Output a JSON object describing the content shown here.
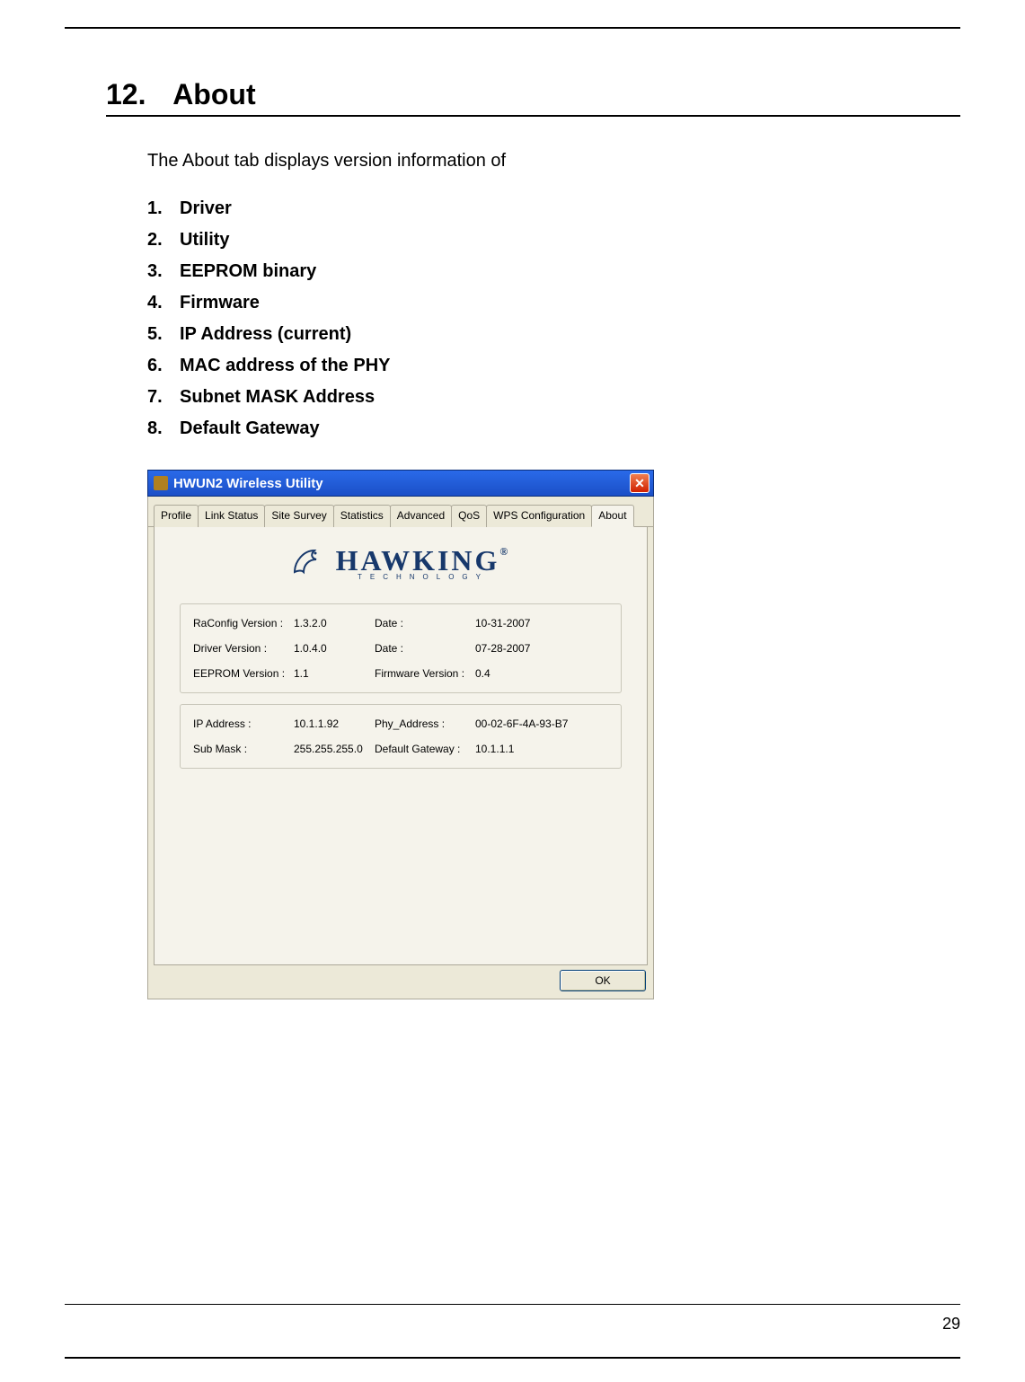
{
  "heading": {
    "num": "12.",
    "title": "About"
  },
  "intro": "The About tab displays version information of",
  "items": [
    {
      "n": "1.",
      "t": "Driver"
    },
    {
      "n": "2.",
      "t": "Utility"
    },
    {
      "n": "3.",
      "t": "EEPROM binary"
    },
    {
      "n": "4.",
      "t": "Firmware"
    },
    {
      "n": "5.",
      "t": "IP Address (current)"
    },
    {
      "n": "6.",
      "t": "MAC address of the PHY"
    },
    {
      "n": "7.",
      "t": "Subnet MASK Address"
    },
    {
      "n": "8.",
      "t": "Default Gateway"
    }
  ],
  "window": {
    "title": "HWUN2 Wireless Utility",
    "close_glyph": "✕",
    "tabs": [
      "Profile",
      "Link Status",
      "Site Survey",
      "Statistics",
      "Advanced",
      "QoS",
      "WPS Configuration",
      "About"
    ],
    "active_tab_index": 7,
    "logo_main": "HAWKING",
    "logo_sub": "TECHNOLOGY",
    "logo_reg": "®",
    "group1": {
      "r1": {
        "l1": "RaConfig Version :",
        "v1": "1.3.2.0",
        "l2": "Date :",
        "v2": "10-31-2007"
      },
      "r2": {
        "l1": "Driver Version :",
        "v1": "1.0.4.0",
        "l2": "Date :",
        "v2": "07-28-2007"
      },
      "r3": {
        "l1": "EEPROM Version :",
        "v1": "1.1",
        "l2": "Firmware Version :",
        "v2": "0.4"
      }
    },
    "group2": {
      "r1": {
        "l1": "IP Address :",
        "v1": "10.1.1.92",
        "l2": "Phy_Address :",
        "v2": "00-02-6F-4A-93-B7"
      },
      "r2": {
        "l1": "Sub Mask :",
        "v1": "255.255.255.0",
        "l2": "Default Gateway :",
        "v2": "10.1.1.1"
      }
    },
    "ok_label": "OK"
  },
  "page_number": "29"
}
